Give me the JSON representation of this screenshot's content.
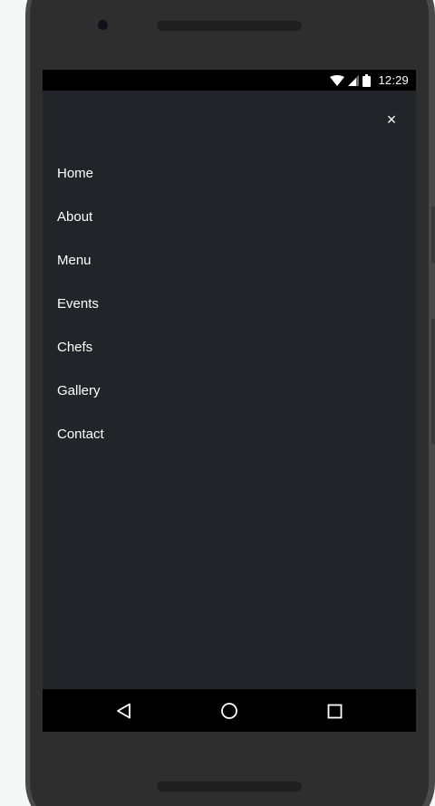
{
  "status_bar": {
    "time": "12:29",
    "icons": [
      "wifi-icon",
      "signal-icon",
      "battery-icon"
    ]
  },
  "drawer": {
    "close_label": "×",
    "items": [
      {
        "label": "Home"
      },
      {
        "label": "About"
      },
      {
        "label": "Menu"
      },
      {
        "label": "Events"
      },
      {
        "label": "Chefs"
      },
      {
        "label": "Gallery"
      },
      {
        "label": "Contact"
      }
    ]
  },
  "system_nav": {
    "buttons": [
      "back-icon",
      "home-icon",
      "recents-icon"
    ]
  },
  "colors": {
    "screen_bg": "#232429",
    "text": "#ffffff",
    "bars": "#000000",
    "frame": "#2e2e2e",
    "page_bg": "#f6f8f8"
  }
}
